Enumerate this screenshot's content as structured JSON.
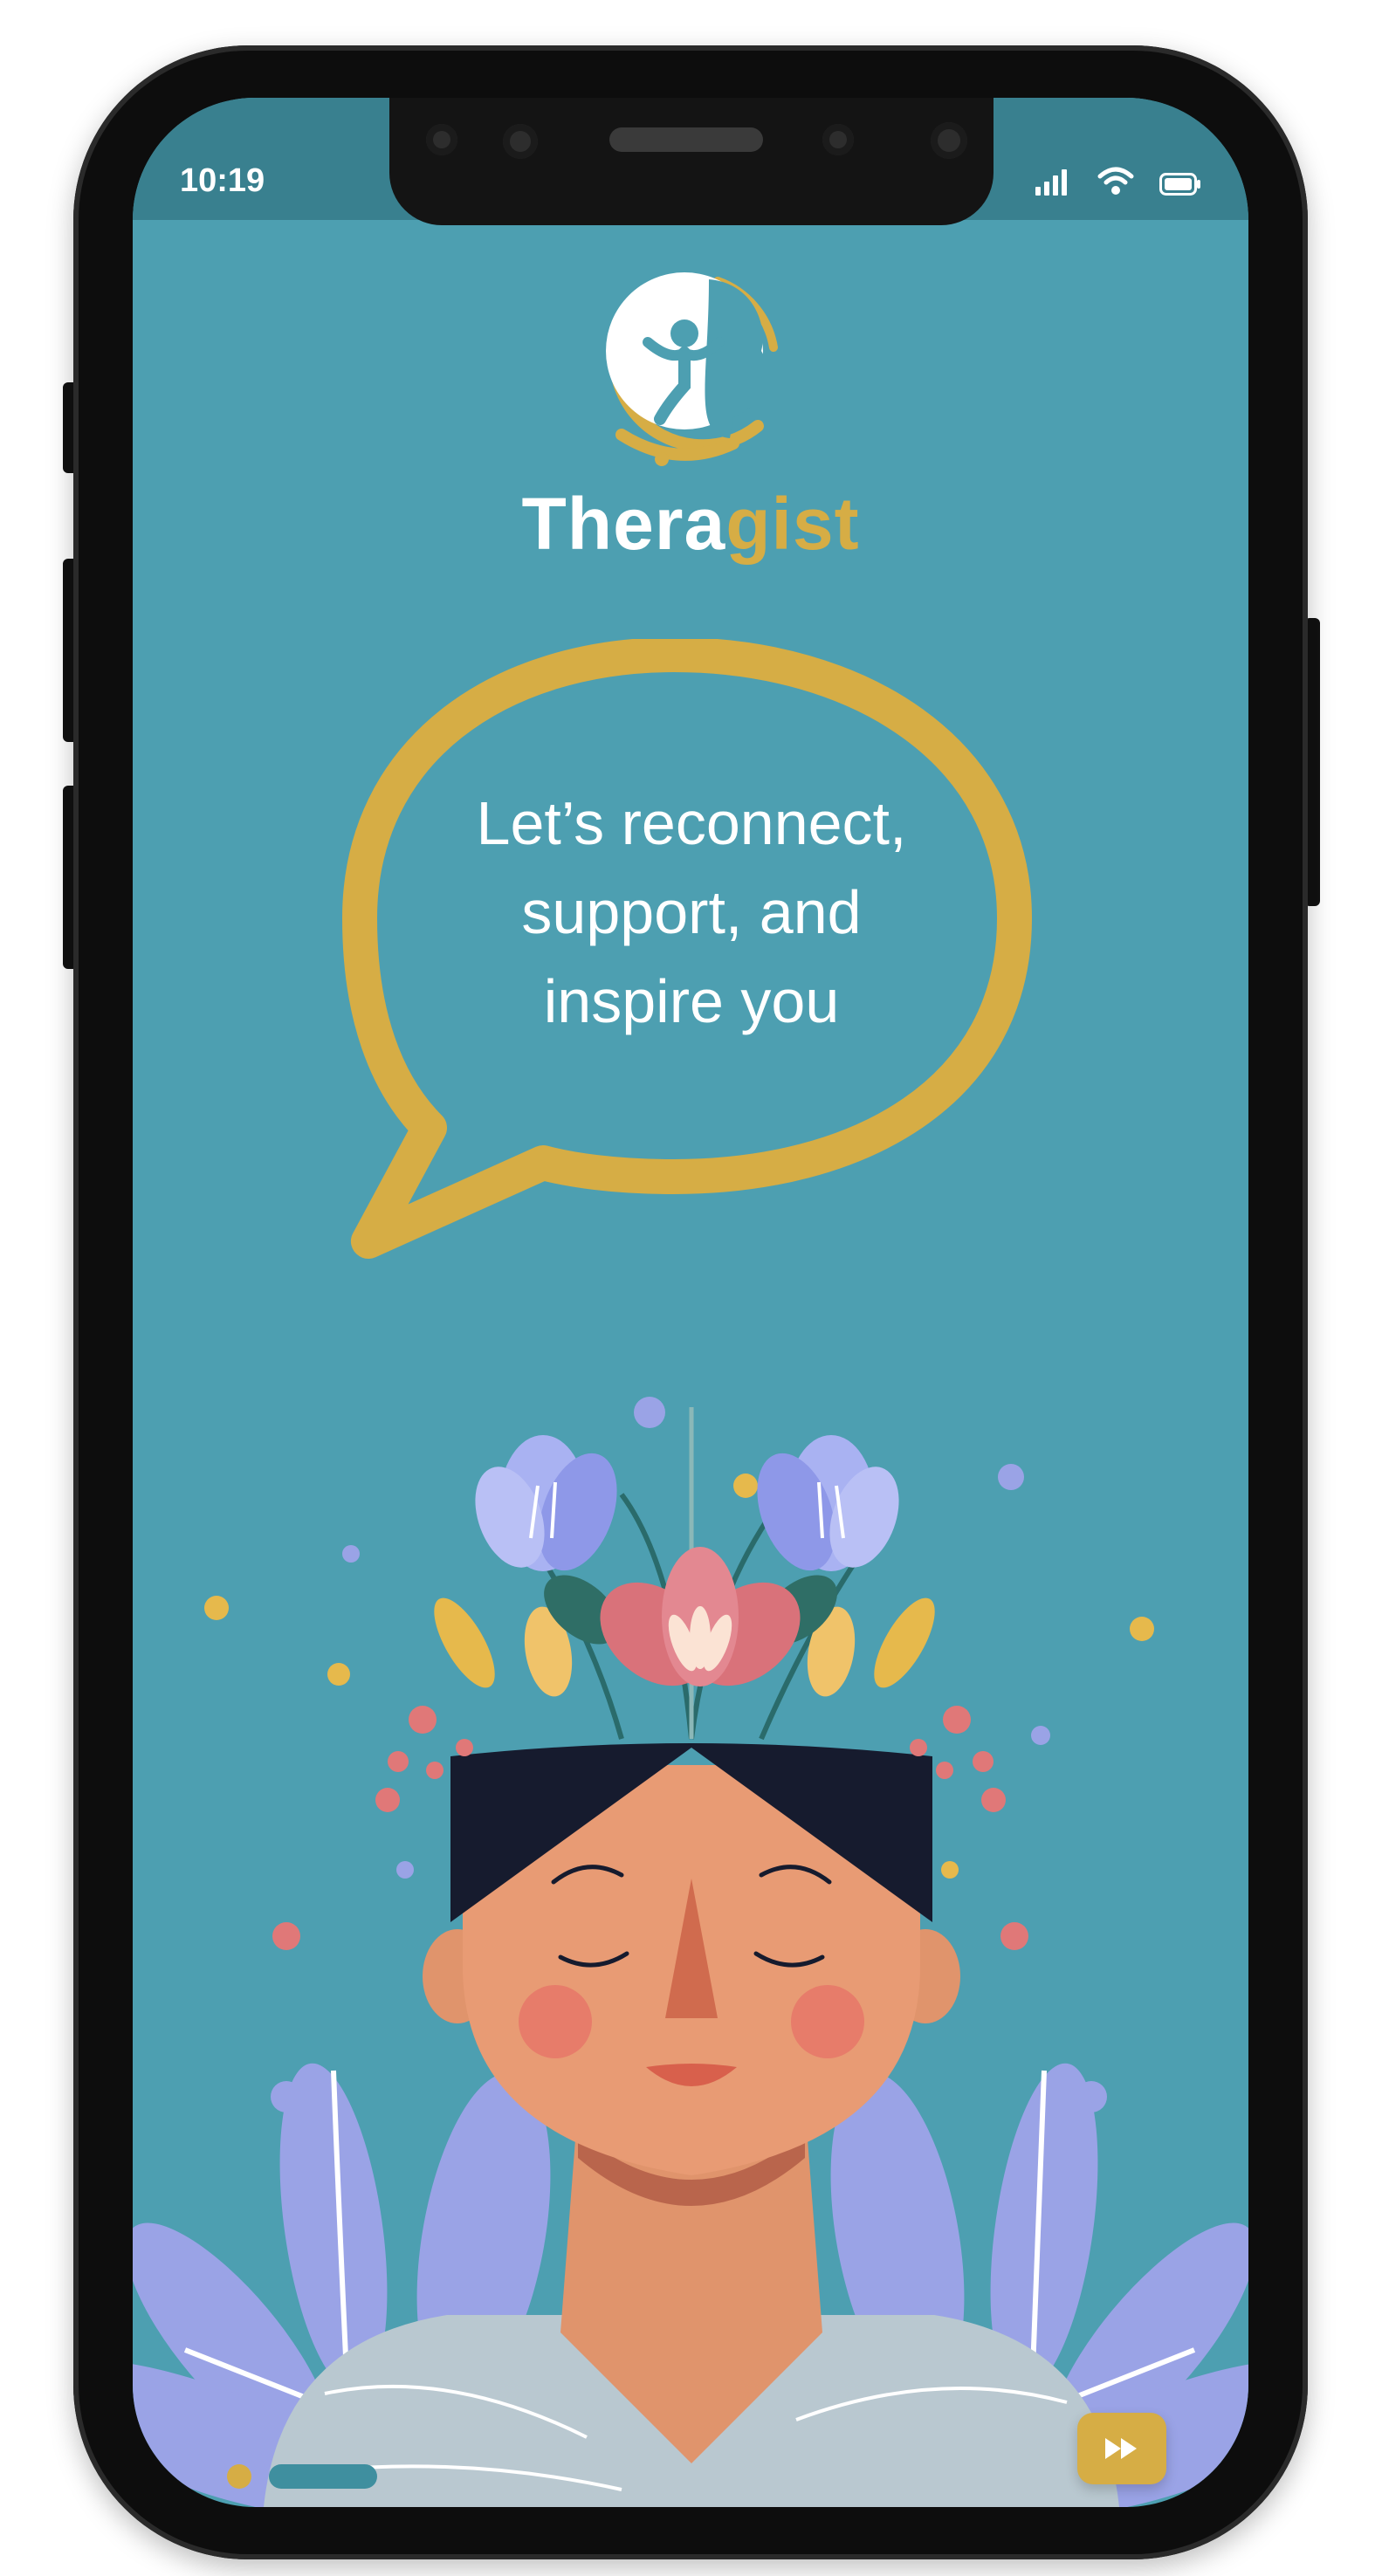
{
  "status_bar": {
    "time": "10:19",
    "icons": [
      "signal-icon",
      "wifi-icon",
      "battery-icon"
    ]
  },
  "brand": {
    "name_part1": "Thera",
    "name_part2": "gist",
    "logo_icon": "head-with-figure-icon"
  },
  "onboarding": {
    "message_line1": "Let’s reconnect,",
    "message_line2": "support, and",
    "message_line3": "inspire you",
    "illustration": "person-with-flowers-illustration",
    "pages_total": 2,
    "current_page": 1,
    "skip_icon": "fast-forward-icon"
  },
  "colors": {
    "background": "#4d9fb1",
    "accent": "#d6ad45",
    "status_bar": "#39808f",
    "text": "#ffffff"
  }
}
